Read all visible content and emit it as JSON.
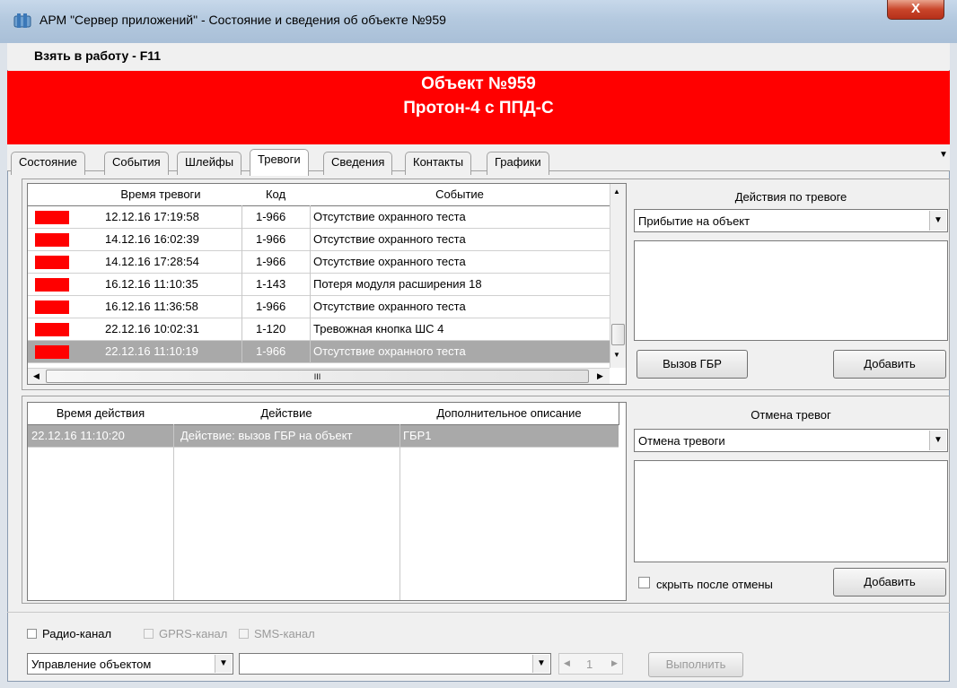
{
  "window": {
    "title": "АРМ \"Сервер приложений\" - Состояние и сведения об объекте №959",
    "close_label": "X"
  },
  "toolbar": {
    "take_to_work": "Взять в работу - F11"
  },
  "banner": {
    "line1": "Объект №959",
    "line2": "Протон-4 с ППД-С"
  },
  "tabs": [
    {
      "label": "Состояние"
    },
    {
      "label": "События"
    },
    {
      "label": "Шлейфы"
    },
    {
      "label": "Тревоги",
      "active": true
    },
    {
      "label": "Сведения"
    },
    {
      "label": "Контакты"
    },
    {
      "label": "Графики"
    }
  ],
  "alarms": {
    "columns": [
      "",
      "Время тревоги",
      "Код",
      "Событие"
    ],
    "rows": [
      {
        "time": "12.12.16  17:19:58",
        "code": "1-966",
        "event": "Отсутствие охранного теста"
      },
      {
        "time": "14.12.16  16:02:39",
        "code": "1-966",
        "event": "Отсутствие охранного теста"
      },
      {
        "time": "14.12.16  17:28:54",
        "code": "1-966",
        "event": "Отсутствие охранного теста"
      },
      {
        "time": "16.12.16  11:10:35",
        "code": "1-143",
        "event": "Потеря модуля расширения 18"
      },
      {
        "time": "16.12.16  11:36:58",
        "code": "1-966",
        "event": "Отсутствие охранного теста"
      },
      {
        "time": "22.12.16  10:02:31",
        "code": "1-120",
        "event": "Тревожная кнопка ШС 4"
      },
      {
        "time": "22.12.16  11:10:19",
        "code": "1-966",
        "event": "Отсутствие охранного теста",
        "selected": true
      }
    ],
    "hscroll_glyph": "III"
  },
  "alarm_actions": {
    "title": "Действия по тревоге",
    "selected": "Прибытие на объект",
    "call_button": "Вызов ГБР",
    "add_button": "Добавить"
  },
  "actions": {
    "columns": [
      "Время действия",
      "Действие",
      "Дополнительное описание"
    ],
    "rows": [
      {
        "time": "22.12.16  11:10:20",
        "action": "Действие: вызов ГБР на объект",
        "desc": "ГБР1",
        "selected": true
      }
    ]
  },
  "cancel": {
    "title": "Отмена тревог",
    "selected": "Отмена тревоги",
    "hide_label": "скрыть после отмены",
    "add_button": "Добавить"
  },
  "channels": {
    "radio": "Радио-канал",
    "gprs": "GPRS-канал",
    "sms": "SMS-канал"
  },
  "control": {
    "mode": "Управление объектом",
    "command": "",
    "counter": "1",
    "execute_button": "Выполнить"
  },
  "colors": {
    "banner": "#ff0000",
    "alarm_marker": "#ff0000",
    "selection": "#a9a9a9"
  }
}
